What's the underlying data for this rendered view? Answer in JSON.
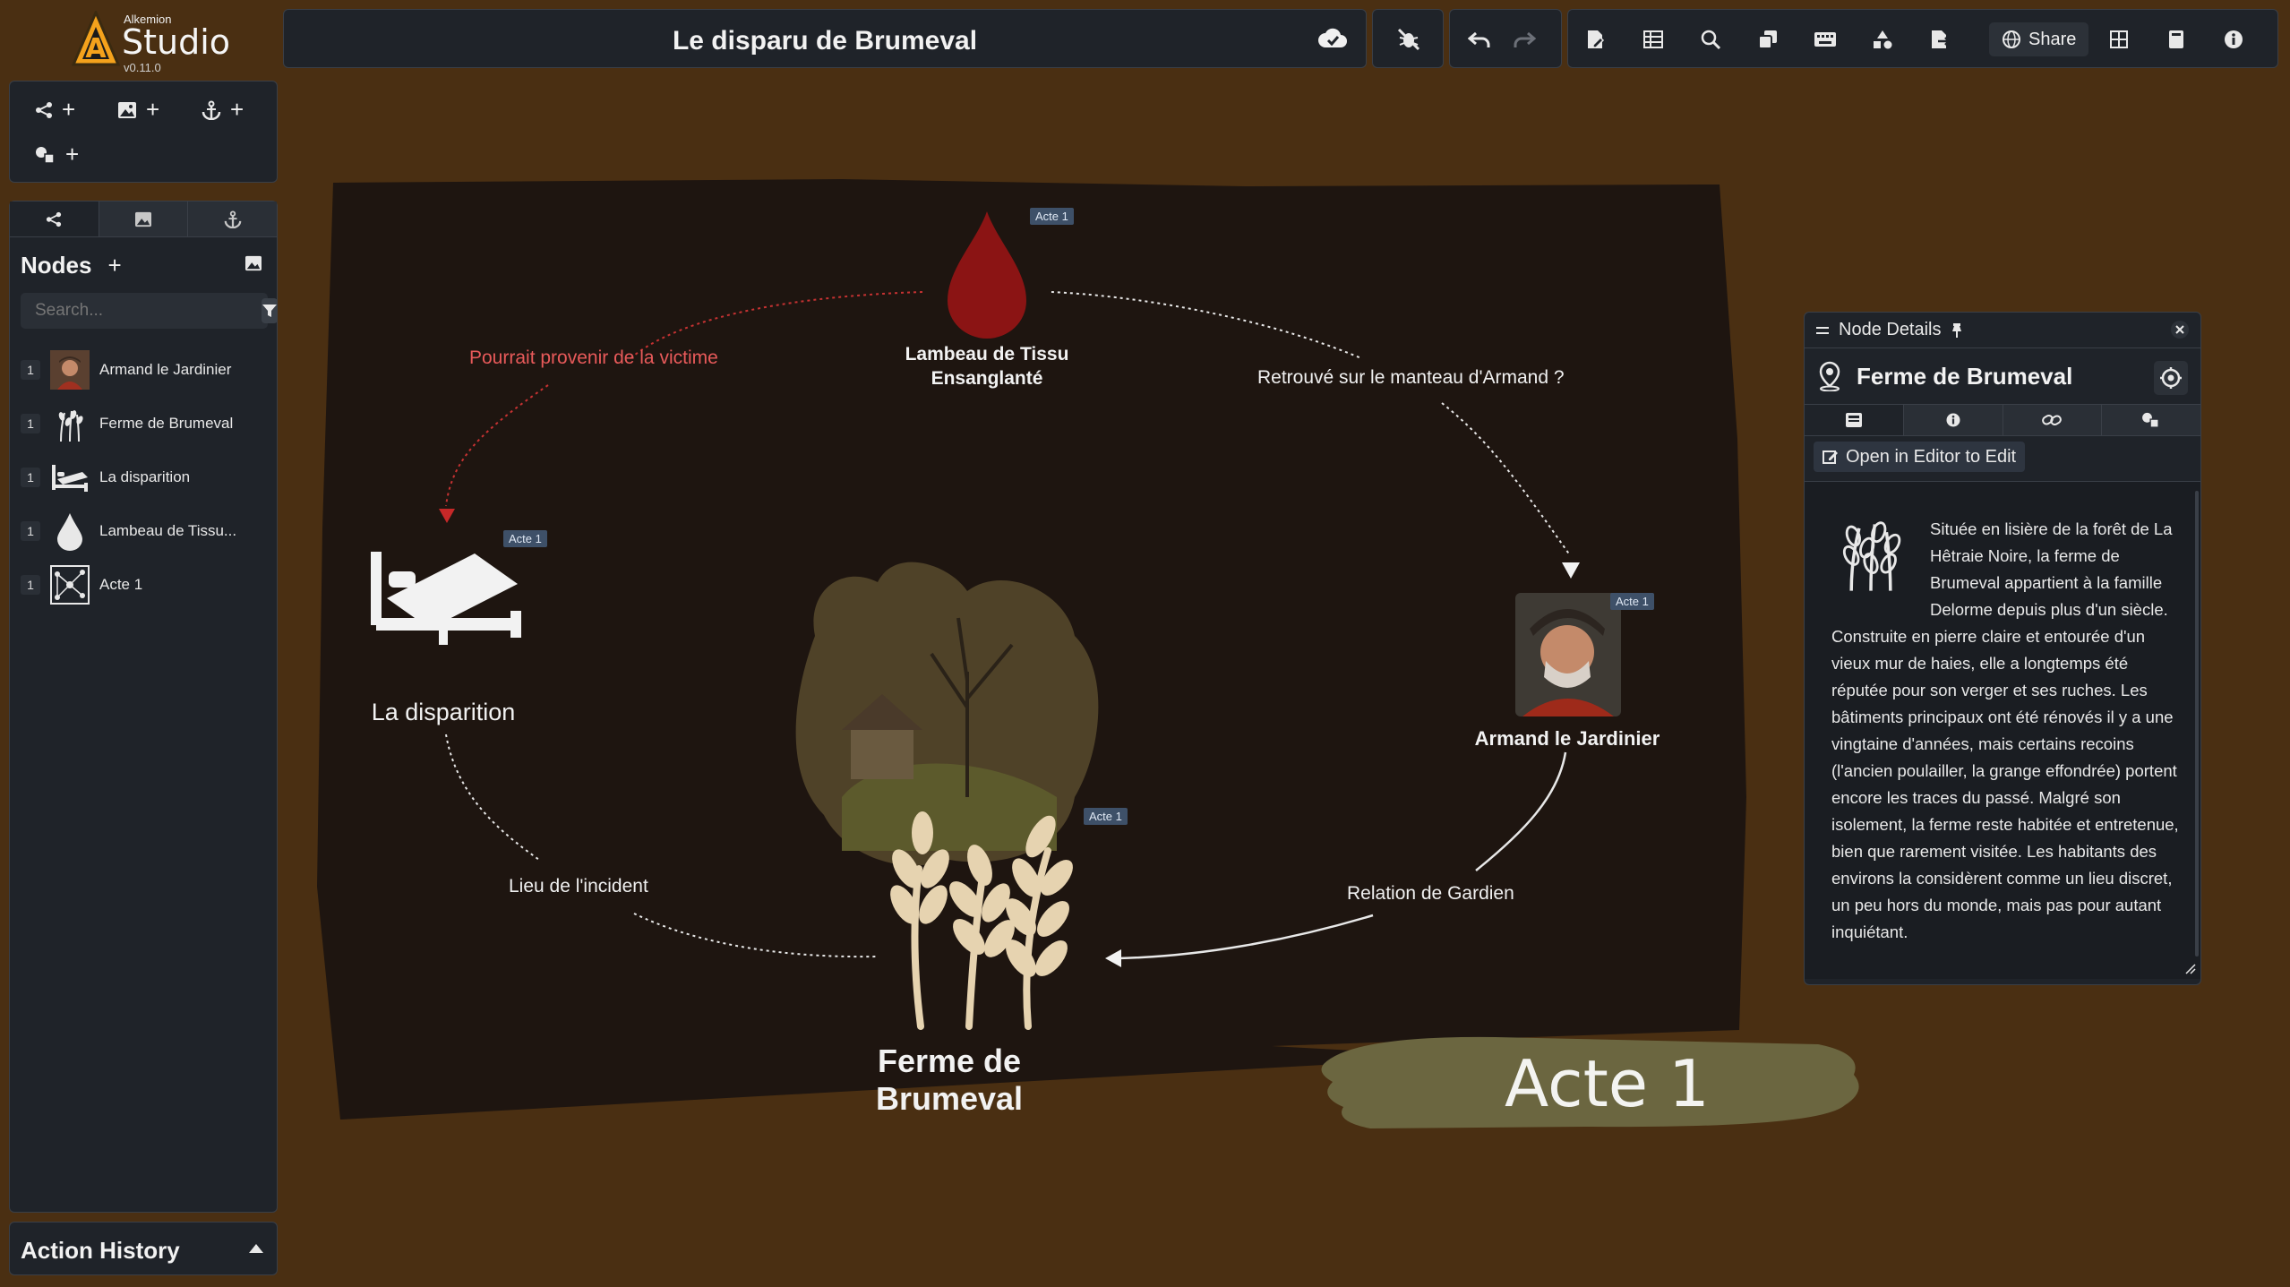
{
  "app": {
    "brand_small": "Alkemion",
    "brand_name": "Studio",
    "version": "v0.11.0"
  },
  "header": {
    "title": "Le disparu de Brumeval",
    "share_label": "Share"
  },
  "left_panel": {
    "nodes_heading": "Nodes",
    "search_placeholder": "Search...",
    "nodes": [
      {
        "count": "1",
        "label": "Armand le Jardinier",
        "icon": "portrait-icon"
      },
      {
        "count": "1",
        "label": "Ferme de Brumeval",
        "icon": "wheat-icon"
      },
      {
        "count": "1",
        "label": "La disparition",
        "icon": "bed-icon"
      },
      {
        "count": "1",
        "label": "Lambeau de Tissu...",
        "icon": "drop-icon"
      },
      {
        "count": "1",
        "label": "Acte 1",
        "icon": "graph-icon"
      }
    ],
    "action_history_label": "Action History"
  },
  "canvas": {
    "nodes": {
      "lambeau": {
        "label_line1": "Lambeau de Tissu",
        "label_line2": "Ensanglanté",
        "badge": "Acte 1"
      },
      "disparition": {
        "label": "La disparition",
        "badge": "Acte 1"
      },
      "armand": {
        "label": "Armand le Jardinier",
        "badge": "Acte 1"
      },
      "ferme": {
        "label": "Ferme de Brumeval",
        "badge": "Acte 1"
      }
    },
    "edges": {
      "pourrait": "Pourrait provenir de la victime",
      "retrouve": "Retrouvé sur le manteau d'Armand ?",
      "lieu": "Lieu de l'incident",
      "relation": "Relation de Gardien"
    },
    "acte_banner": "Acte 1",
    "colors": {
      "board": "#1e1510",
      "blood": "#8b1414",
      "wheat": "#e6d3b0",
      "banner": "#6b6640"
    }
  },
  "details": {
    "header": "Node Details",
    "title": "Ferme de Brumeval",
    "open_editor": "Open in Editor to Edit",
    "description": "Située en lisière de la forêt de La Hêtraie Noire, la ferme de Brumeval appartient à la famille Delorme depuis plus d'un siècle. Construite en pierre claire et entourée d'un vieux mur de haies, elle a longtemps été réputée pour son verger et ses ruches. Les bâtiments principaux ont été rénovés il y a une vingtaine d'années, mais certains recoins (l'ancien poulailler, la grange effondrée) portent encore les traces du passé. Malgré son isolement, la ferme reste habitée et entretenue, bien que rarement visitée. Les habitants des environs la considèrent comme un lieu discret, un peu hors du monde, mais pas pour autant inquiétant."
  }
}
